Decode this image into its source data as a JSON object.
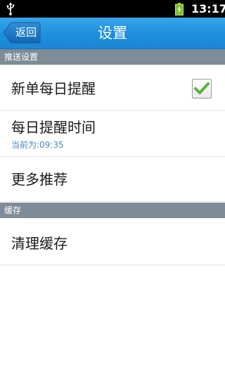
{
  "status_bar": {
    "time": "13:17",
    "icons": [
      "usb-icon",
      "battery-charging-icon"
    ]
  },
  "header": {
    "back_label": "返回",
    "title": "设置",
    "accent": "#1e8fdc"
  },
  "sections": [
    {
      "title": "推送设置",
      "items": [
        {
          "label": "新单每日提醒",
          "checked": true
        },
        {
          "label": "每日提醒时间",
          "sub": "当前为:09:35"
        },
        {
          "label": "更多推荐"
        }
      ]
    },
    {
      "title": "缓存",
      "items": [
        {
          "label": "清理缓存"
        }
      ]
    }
  ]
}
